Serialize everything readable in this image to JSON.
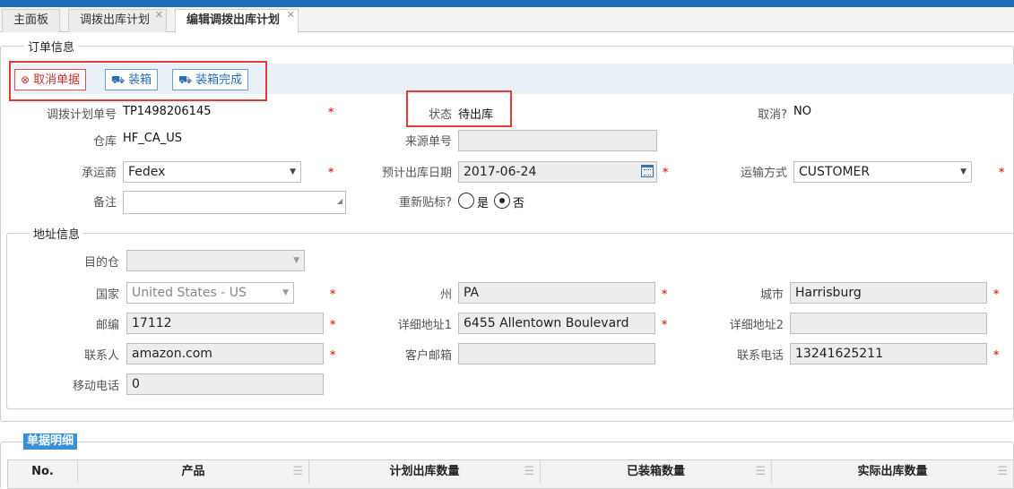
{
  "tabs": [
    {
      "label": "主面板",
      "closable": false
    },
    {
      "label": "调拨出库计划",
      "closable": true
    },
    {
      "label": "编辑调拨出库计划",
      "closable": true
    }
  ],
  "order_section": {
    "legend": "订单信息",
    "toolbar": {
      "cancel_label": "取消单据",
      "pack_label": "装箱",
      "pack_done_label": "装箱完成"
    },
    "fields": {
      "plan_no_label": "调拨计划单号",
      "plan_no_value": "TP1498206145",
      "status_label": "状态",
      "status_value": "待出库",
      "cancel_label": "取消?",
      "cancel_value": "NO",
      "warehouse_label": "仓库",
      "warehouse_value": "HF_CA_US",
      "source_no_label": "来源单号",
      "source_no_value": "",
      "carrier_label": "承运商",
      "carrier_value": "Fedex",
      "eta_label": "预计出库日期",
      "eta_value": "2017-06-24",
      "ship_method_label": "运输方式",
      "ship_method_value": "CUSTOMER",
      "remark_label": "备注",
      "remark_value": "",
      "relabel_label": "重新贴标?",
      "relabel_yes": "是",
      "relabel_no": "否",
      "relabel_selected": "否"
    }
  },
  "address_section": {
    "legend": "地址信息",
    "fields": {
      "dest_wh_label": "目的仓",
      "dest_wh_value": "",
      "country_label": "国家",
      "country_value": "United States - US",
      "state_label": "州",
      "state_value": "PA",
      "city_label": "城市",
      "city_value": "Harrisburg",
      "zip_label": "邮编",
      "zip_value": "17112",
      "addr1_label": "详细地址1",
      "addr1_value": "6455 Allentown Boulevard",
      "addr2_label": "详细地址2",
      "addr2_value": "",
      "contact_label": "联系人",
      "contact_value": "amazon.com",
      "email_label": "客户邮箱",
      "email_value": "",
      "phone_label": "联系电话",
      "phone_value": "13241625211",
      "mobile_label": "移动电话",
      "mobile_value": "0"
    }
  },
  "detail": {
    "title": "单据明细",
    "columns": [
      "No.",
      "产品",
      "计划出库数量",
      "已装箱数量",
      "实际出库数量"
    ]
  },
  "required_mark": "*",
  "colors": {
    "accent": "#1f6fb8",
    "highlight": "#e53935",
    "header_blue": "#3a8fd6"
  }
}
